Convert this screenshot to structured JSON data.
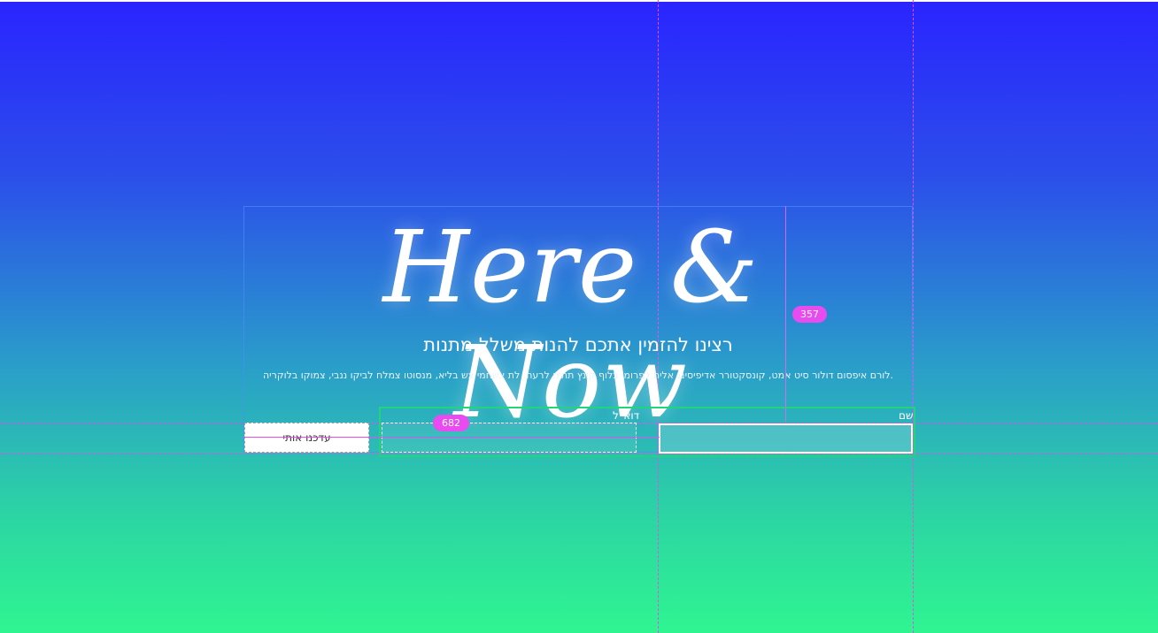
{
  "hero": {
    "logo_text": "Here & Now",
    "subtitle": "רצינו להזמין אתכם להנות משלל מתנות",
    "description": ".לורם איפסום דולור סיט אמט, קונסקטורר אדיפיסינג אלית לפרומי בלוף קינץ תתיח לרעה. לת צשחמי צש בליא, מנסוטו צמלח לביקו ננבי, צמוקו בלוקריה"
  },
  "form": {
    "name_label": "שם",
    "name_value": "",
    "email_label": "דוא\"ל",
    "email_value": "",
    "submit_label": "עדכנו אותי"
  },
  "editor_overlay": {
    "height_badge": "357",
    "width_badge": "682",
    "guide_color": "#e84cf0",
    "selection_color": "#22d47a"
  },
  "colors": {
    "gradient_top": "#2a24ff",
    "gradient_bottom": "#2ff591",
    "text": "#ffffff"
  }
}
